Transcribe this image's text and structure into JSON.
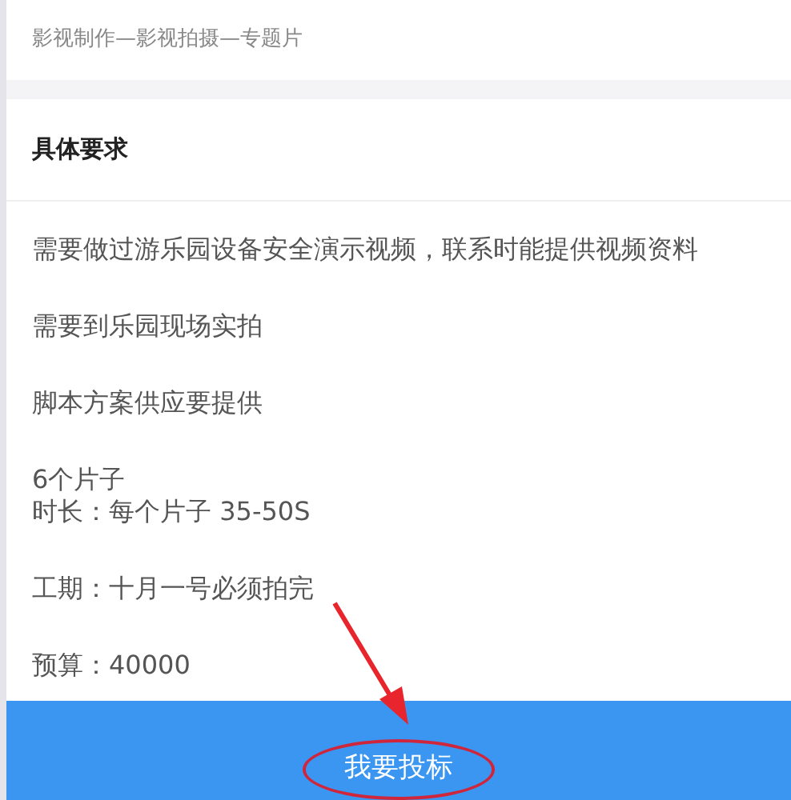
{
  "category": "影视制作—影视拍摄—专题片",
  "section_title": "具体要求",
  "requirements": [
    {
      "lines": [
        "需要做过游乐园设备安全演示视频，联系时能提供视频资料"
      ]
    },
    {
      "lines": [
        "需要到乐园现场实拍"
      ]
    },
    {
      "lines": [
        "脚本方案供应要提供"
      ]
    },
    {
      "lines": [
        "6个片子",
        "时长：每个片子 35-50S"
      ]
    },
    {
      "lines": [
        "工期：十月一号必须拍完"
      ]
    },
    {
      "lines": [
        "预算：40000"
      ]
    }
  ],
  "bid_button": {
    "label": "我要投标",
    "highlighted": true
  }
}
